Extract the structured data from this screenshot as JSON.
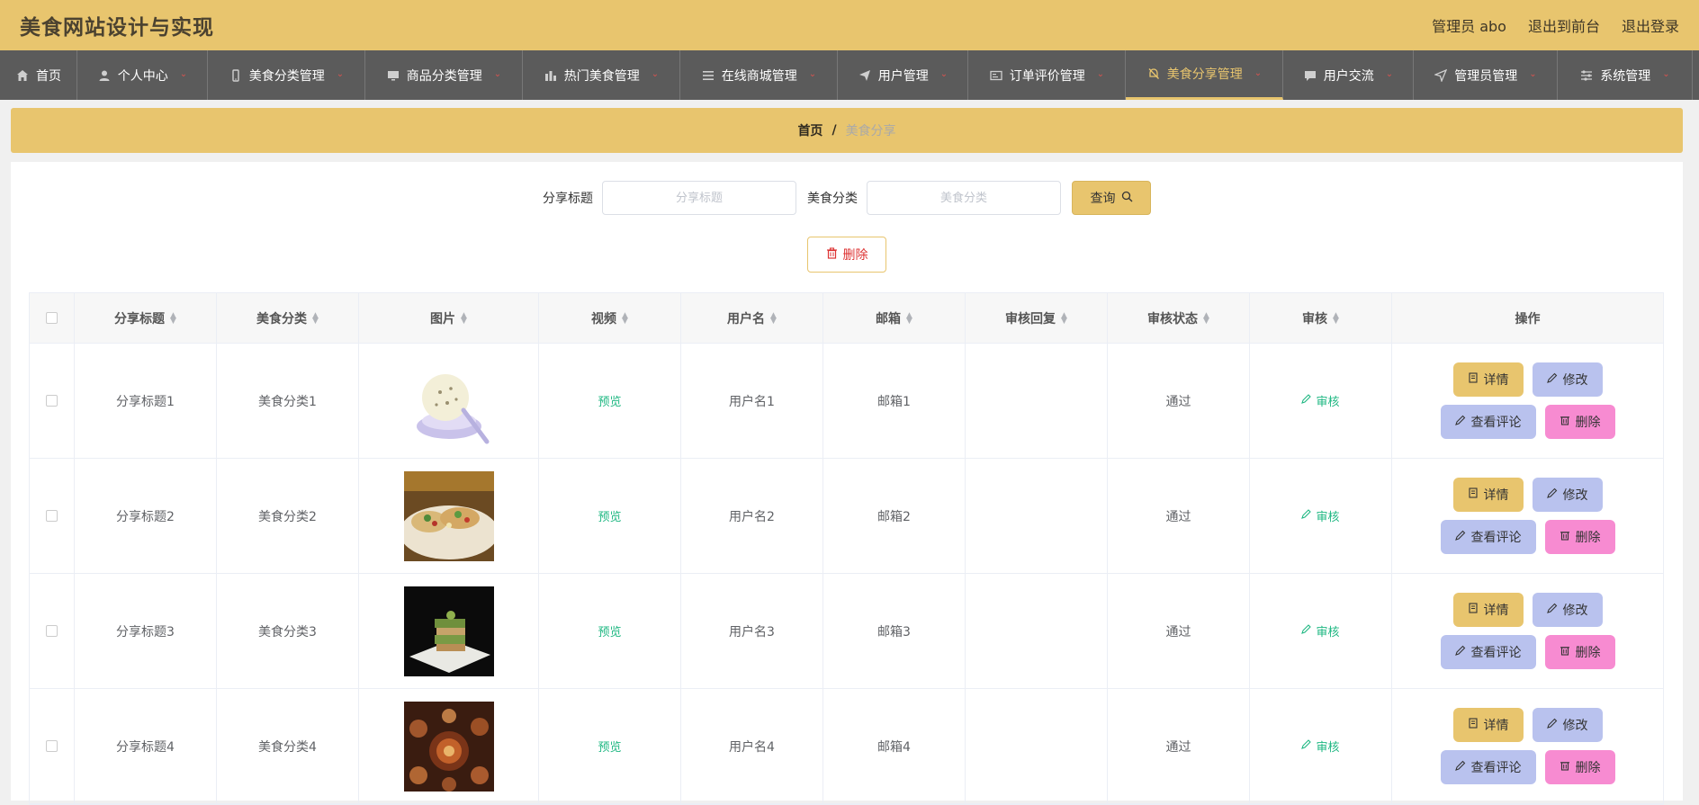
{
  "header": {
    "title": "美食网站设计与实现",
    "admin": "管理员 abo",
    "to_front": "退出到前台",
    "logout": "退出登录"
  },
  "nav": [
    {
      "label": "首页",
      "icon": "home-icon",
      "chevron": false,
      "active": false
    },
    {
      "label": "个人中心",
      "icon": "user-icon",
      "chevron": true,
      "active": false
    },
    {
      "label": "美食分类管理",
      "icon": "phone-icon",
      "chevron": true,
      "active": false
    },
    {
      "label": "商品分类管理",
      "icon": "monitor-icon",
      "chevron": true,
      "active": false
    },
    {
      "label": "热门美食管理",
      "icon": "bar-chart-icon",
      "chevron": true,
      "active": false
    },
    {
      "label": "在线商城管理",
      "icon": "list-icon",
      "chevron": true,
      "active": false
    },
    {
      "label": "用户管理",
      "icon": "send-icon",
      "chevron": true,
      "active": false
    },
    {
      "label": "订单评价管理",
      "icon": "card-icon",
      "chevron": true,
      "active": false
    },
    {
      "label": "美食分享管理",
      "icon": "bell-off-icon",
      "chevron": true,
      "active": true
    },
    {
      "label": "用户交流",
      "icon": "chat-icon",
      "chevron": true,
      "active": false
    },
    {
      "label": "管理员管理",
      "icon": "navigation-icon",
      "chevron": true,
      "active": false
    },
    {
      "label": "系统管理",
      "icon": "sliders-icon",
      "chevron": true,
      "active": false
    }
  ],
  "breadcrumb": {
    "home": "首页",
    "sep": "/",
    "current": "美食分享"
  },
  "search": {
    "title_label": "分享标题",
    "title_placeholder": "分享标题",
    "category_label": "美食分类",
    "category_placeholder": "美食分类",
    "query_label": "查询"
  },
  "delete_label": "删除",
  "table": {
    "headers": [
      "分享标题",
      "美食分类",
      "图片",
      "视频",
      "用户名",
      "邮箱",
      "审核回复",
      "审核状态",
      "审核",
      "操作"
    ],
    "rows": [
      {
        "title": "分享标题1",
        "category": "美食分类1",
        "image": "ice-cream",
        "video": "预览",
        "username": "用户名1",
        "email": "邮箱1",
        "reply": "",
        "status": "通过",
        "audit": "审核"
      },
      {
        "title": "分享标题2",
        "category": "美食分类2",
        "image": "tacos",
        "video": "预览",
        "username": "用户名2",
        "email": "邮箱2",
        "reply": "",
        "status": "通过",
        "audit": "审核"
      },
      {
        "title": "分享标题3",
        "category": "美食分类3",
        "image": "stacked-dish",
        "video": "预览",
        "username": "用户名3",
        "email": "邮箱3",
        "reply": "",
        "status": "通过",
        "audit": "审核"
      },
      {
        "title": "分享标题4",
        "category": "美食分类4",
        "image": "hotpot",
        "video": "预览",
        "username": "用户名4",
        "email": "邮箱4",
        "reply": "",
        "status": "通过",
        "audit": "审核"
      }
    ],
    "actions": {
      "detail": "详情",
      "edit": "修改",
      "comments": "查看评论",
      "delete": "删除"
    }
  },
  "colors": {
    "accent": "#e8c56e",
    "nav_bg": "#5b5b5b",
    "green": "#20b883",
    "lavender": "#b9c2ee",
    "pink": "#f78bd1"
  }
}
